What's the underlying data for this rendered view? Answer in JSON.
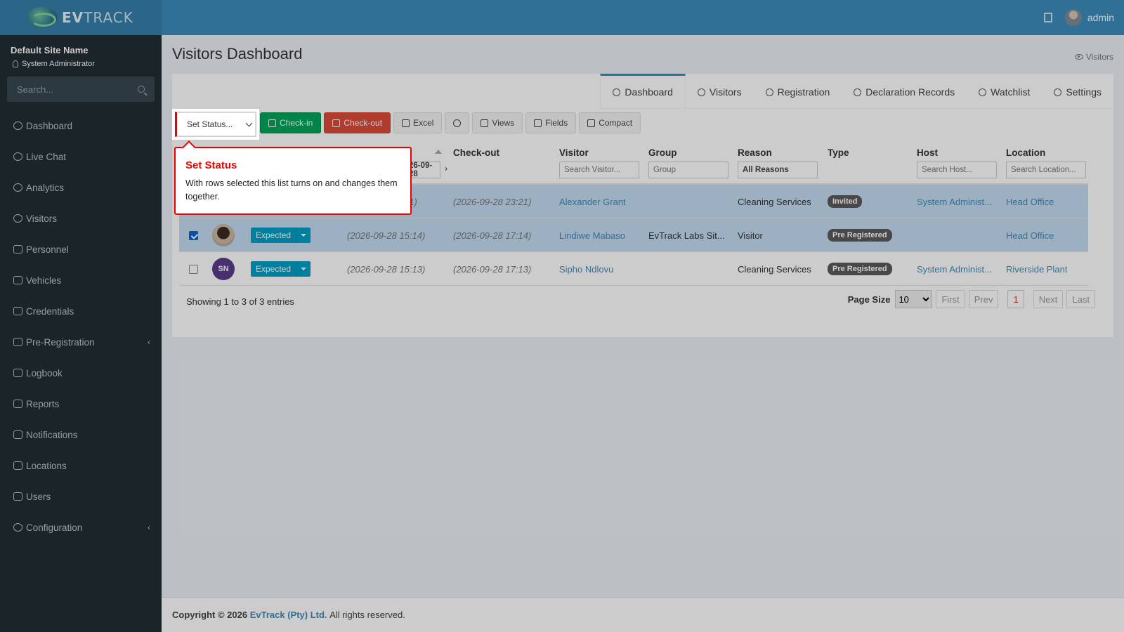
{
  "header": {
    "logo_text_bold": "EV",
    "logo_text": "TRACK",
    "username": "admin"
  },
  "sidebar": {
    "site_name": "Default Site Name",
    "role": "System Administrator",
    "search_placeholder": "Search...",
    "items": [
      {
        "label": "Dashboard",
        "icon": "dashboard-icon"
      },
      {
        "label": "Live Chat",
        "icon": "headset-icon"
      },
      {
        "label": "Analytics",
        "icon": "target-icon"
      },
      {
        "label": "Visitors",
        "icon": "eye-icon"
      },
      {
        "label": "Personnel",
        "icon": "user-tie-icon"
      },
      {
        "label": "Vehicles",
        "icon": "bus-icon"
      },
      {
        "label": "Credentials",
        "icon": "id-card-icon"
      },
      {
        "label": "Pre-Registration",
        "icon": "exchange-icon",
        "expandable": true
      },
      {
        "label": "Logbook",
        "icon": "book-icon"
      },
      {
        "label": "Reports",
        "icon": "chart-icon"
      },
      {
        "label": "Notifications",
        "icon": "comments-icon"
      },
      {
        "label": "Locations",
        "icon": "building-icon"
      },
      {
        "label": "Users",
        "icon": "users-icon"
      },
      {
        "label": "Configuration",
        "icon": "gear-icon",
        "expandable": true
      }
    ],
    "chevron": "‹"
  },
  "page": {
    "title": "Visitors Dashboard",
    "breadcrumb": "Visitors"
  },
  "tabs": [
    {
      "label": "Dashboard",
      "active": true
    },
    {
      "label": "Visitors"
    },
    {
      "label": "Registration"
    },
    {
      "label": "Declaration Records"
    },
    {
      "label": "Watchlist"
    },
    {
      "label": "Settings"
    }
  ],
  "toolbar": {
    "status_select": "Set Status...",
    "checkin": "Check-in",
    "checkout": "Check-out",
    "excel": "Excel",
    "views": "Views",
    "fields": "Fields",
    "compact": "Compact"
  },
  "table": {
    "headers": {
      "checkout": "Check-out",
      "visitor": "Visitor",
      "group": "Group",
      "reason": "Reason",
      "type": "Type",
      "host": "Host",
      "location": "Location"
    },
    "filters": {
      "date_value": "26-09-28",
      "visitor_placeholder": "Search Visitor...",
      "group_placeholder": "Group",
      "reason_value": "All Reasons",
      "host_placeholder": "Search Host...",
      "location_placeholder": "Search Location..."
    },
    "rows": [
      {
        "selected": true,
        "checkin": "21)",
        "checkout": "(2026-09-28 23:21)",
        "visitor": "Alexander Grant",
        "group": "",
        "reason": "Cleaning Services",
        "type": "Invited",
        "host": "System Administ...",
        "location": "Head Office"
      },
      {
        "selected": true,
        "status": "Expected",
        "checkin": "(2026-09-28 15:14)",
        "checkout": "(2026-09-28 17:14)",
        "visitor": "Lindiwe Mabaso",
        "group": "EvTrack Labs Sit...",
        "reason": "Visitor",
        "type": "Pre Registered",
        "host": "",
        "location": "Head Office"
      },
      {
        "selected": false,
        "initials": "SN",
        "status": "Expected",
        "checkin": "(2026-09-28 15:13)",
        "checkout": "(2026-09-28 17:13)",
        "visitor": "Sipho Ndlovu",
        "group": "",
        "reason": "Cleaning Services",
        "type": "Pre Registered",
        "host": "System Administ...",
        "location": "Riverside Plant"
      }
    ]
  },
  "pagination": {
    "showing": "Showing 1 to 3 of 3 entries",
    "page_size_label": "Page Size",
    "page_size": "10",
    "first": "First",
    "prev": "Prev",
    "current": "1",
    "next": "Next",
    "last": "Last"
  },
  "footer": {
    "copyright": "Copyright © 2026",
    "company": "EvTrack (Pty) Ltd.",
    "rights": "All rights reserved."
  },
  "tooltip": {
    "title": "Set Status",
    "body": "With rows selected this list turns on and changes them together."
  }
}
